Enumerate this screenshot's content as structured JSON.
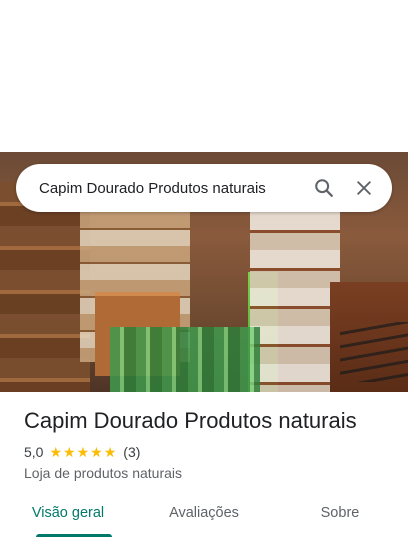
{
  "search": {
    "query": "Capim Dourado Produtos naturais",
    "search_icon": "search-icon",
    "close_icon": "close-icon"
  },
  "photo": {
    "subject": "store-interior-photo"
  },
  "place": {
    "name": "Capim Dourado Produtos naturais",
    "rating_value": "5,0",
    "stars": [
      "★",
      "★",
      "★",
      "★",
      "★"
    ],
    "review_count": "(3)",
    "category": "Loja de produtos naturais"
  },
  "tabs": [
    {
      "label": "Visão geral",
      "active": true
    },
    {
      "label": "Avaliações",
      "active": false
    },
    {
      "label": "Sobre",
      "active": false
    }
  ],
  "colors": {
    "accent": "#00796b",
    "star": "#fbbc04",
    "text_primary": "#202124",
    "text_secondary": "#5f6368"
  }
}
